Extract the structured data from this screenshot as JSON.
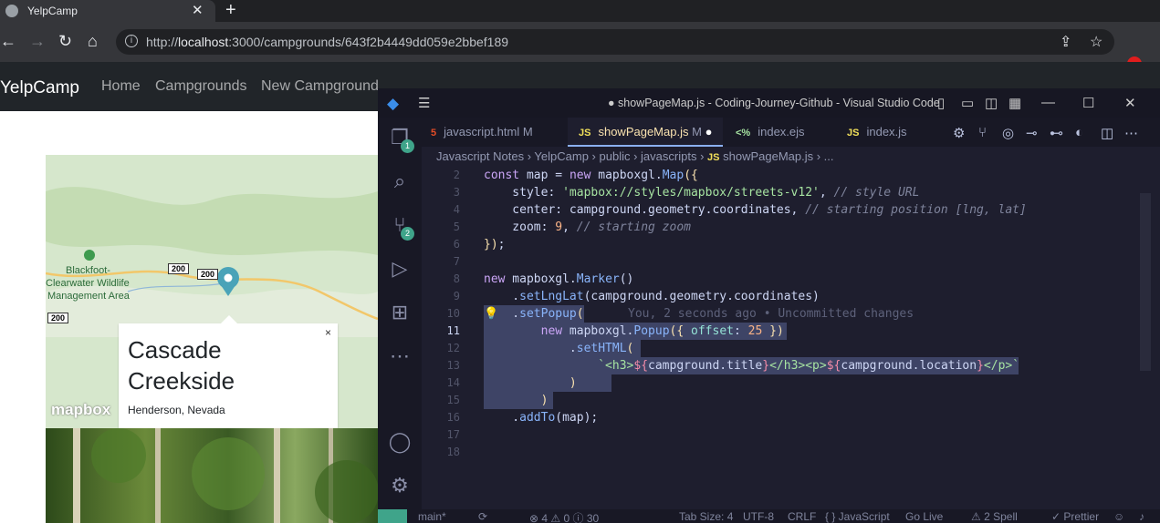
{
  "browser": {
    "tab_title": "YelpCamp",
    "url_prefix": "http://",
    "url_host": "localhost",
    "url_rest": ":3000/campgrounds/643f2b4449dd059e2bbef189"
  },
  "site": {
    "brand": "YelpCamp",
    "nav": [
      "Home",
      "Campgrounds",
      "New Campground"
    ],
    "map": {
      "labels": [
        "Blackfoot-",
        "Clearwater Wildlife",
        "Management Area"
      ],
      "route_shields": [
        "200",
        "200",
        "200"
      ],
      "logo": "mapbox"
    },
    "popup": {
      "title": "Cascade Creekside",
      "location": "Henderson, Nevada",
      "close": "×"
    }
  },
  "vscode": {
    "window_title": "● showPageMap.js - Coding-Journey-Github - Visual Studio Code",
    "activity_badges": [
      "1",
      "2"
    ],
    "tabs": [
      {
        "label": "javascript.html",
        "lang": "5",
        "modified": "M",
        "color": "#e34c26"
      },
      {
        "label": "showPageMap.js",
        "lang": "JS",
        "modified": "M",
        "color": "#f1e05a"
      },
      {
        "label": "index.ejs",
        "lang": "<%",
        "modified": "",
        "color": "#a6e3a1"
      },
      {
        "label": "index.js",
        "lang": "JS",
        "modified": "",
        "color": "#f1e05a"
      }
    ],
    "breadcrumbs": [
      "Javascript Notes",
      "YelpCamp",
      "public",
      "javascripts",
      "showPageMap.js",
      "..."
    ],
    "line_numbers": [
      "2",
      "3",
      "4",
      "5",
      "6",
      "7",
      "8",
      "9",
      "10",
      "11",
      "12",
      "13",
      "14",
      "15",
      "16",
      "17",
      "18"
    ],
    "current_line": "11",
    "blame": "You, 2 seconds ago • Uncommitted changes",
    "status": {
      "branch": "main*",
      "problems": "⊗ 4 ⚠ 0 ⓘ 30",
      "tab_size": "Tab Size: 4",
      "encoding": "UTF-8",
      "eol": "CRLF",
      "language": "{ } JavaScript",
      "go_live": "Go Live",
      "spell": "⚠ 2 Spell",
      "prettier": "✓ Prettier"
    }
  }
}
